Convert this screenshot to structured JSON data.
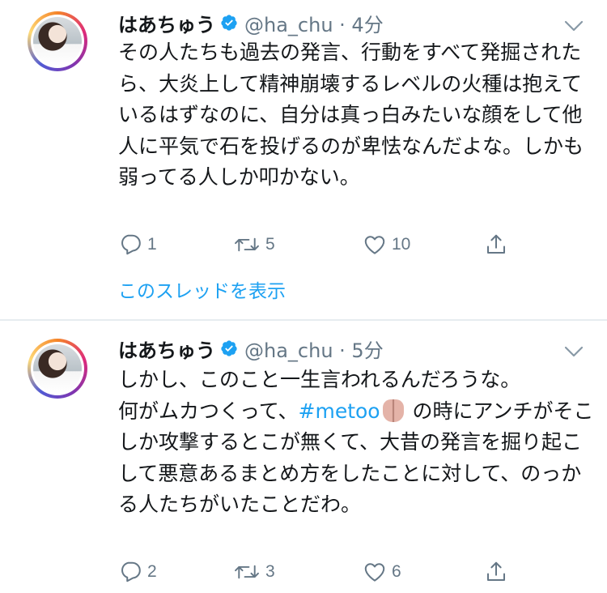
{
  "tweets": [
    {
      "author_name": "はあちゅう",
      "handle_time": "@ha_chu · 4分",
      "text": "その人たちも過去の発言、行動をすべて発掘されたら、大炎上して精神崩壊するレベルの火種は抱えているはずなのに、自分は真っ白みたいな顔をして他人に平気で石を投げるのが卑怯なんだよな。しかも弱ってる人しか叩かない。",
      "replies": "1",
      "retweets": "5",
      "likes": "10",
      "thread_link": "このスレッドを表示"
    },
    {
      "author_name": "はあちゅう",
      "handle_time": "@ha_chu · 5分",
      "text_before": "しかし、このこと一生言われるんだろうな。\n何がムカつくって、",
      "hashtag": "#metoo",
      "text_after": " の時にアンチがそこしか攻撃するとこが無くて、大昔の発言を掘り起こして悪意あるまとめ方をしたことに対して、のっかる人たちがいたことだわ。",
      "replies": "2",
      "retweets": "3",
      "likes": "6"
    }
  ],
  "colors": {
    "text": "#14171a",
    "secondary": "#657786",
    "link": "#1da1f2",
    "divider": "#e6ecf0"
  }
}
